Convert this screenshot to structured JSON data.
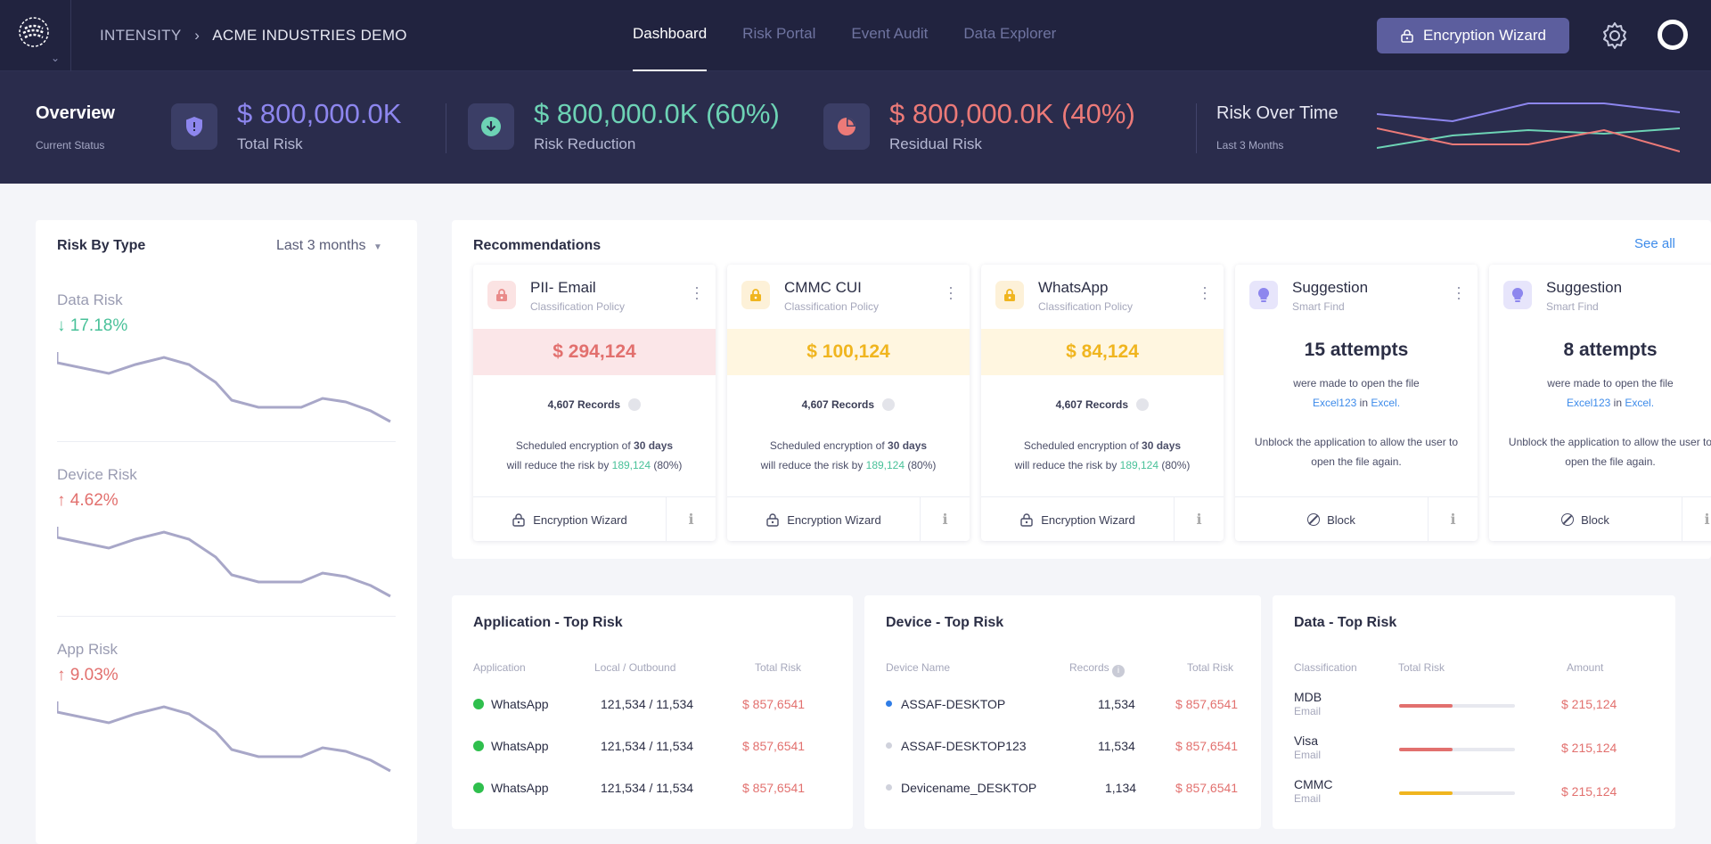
{
  "colors": {
    "total_risk": "#8d86ee",
    "risk_reduction": "#6dd3b5",
    "residual_risk": "#ec7a78",
    "up": "#e2706e",
    "down": "#49c199",
    "amber": "#f0b51f",
    "link": "#3d8bea"
  },
  "header": {
    "breadcrumb": [
      "INTENSITY",
      "ACME INDUSTRIES DEMO"
    ],
    "tabs": [
      "Dashboard",
      "Risk Portal",
      "Event Audit",
      "Data Explorer"
    ],
    "active_tab": "Dashboard",
    "encryption_button": "Encryption Wizard"
  },
  "overview": {
    "title": "Overview",
    "subtitle": "Current Status",
    "total": {
      "value": "$ 800,000.0K",
      "label": "Total Risk"
    },
    "reduction": {
      "value": "$ 800,000.0K",
      "pct": "(60%)",
      "label": "Risk Reduction"
    },
    "residual": {
      "value": "$ 800,000.0K",
      "pct": "(40%)",
      "label": "Residual Risk"
    },
    "risk_over_time": {
      "title": "Risk Over Time",
      "subtitle": "Last 3 Months"
    }
  },
  "risk_by_type": {
    "title": "Risk By Type",
    "period": "Last 3 months",
    "items": [
      {
        "name": "Data Risk",
        "change": "17.18%",
        "direction": "down"
      },
      {
        "name": "Device Risk",
        "change": "4.62%",
        "direction": "up"
      },
      {
        "name": "App Risk",
        "change": "9.03%",
        "direction": "up"
      }
    ]
  },
  "recommendations": {
    "title": "Recommendations",
    "see_all": "See all",
    "policy_cards": [
      {
        "title": "PII- Email",
        "subtitle": "Classification Policy",
        "amount": "$ 294,124",
        "records": "4,607 Records",
        "desc_a": "Scheduled encryption of ",
        "desc_bold": "30 days",
        "desc_b": "will reduce the risk by ",
        "desc_val": "189,124",
        "desc_pct": " (80%)",
        "action": "Encryption Wizard"
      },
      {
        "title": "CMMC CUI",
        "subtitle": "Classification Policy",
        "amount": "$ 100,124",
        "records": "4,607 Records",
        "desc_a": "Scheduled encryption of ",
        "desc_bold": "30 days",
        "desc_b": "will reduce the risk by ",
        "desc_val": "189,124",
        "desc_pct": " (80%)",
        "action": "Encryption Wizard"
      },
      {
        "title": "WhatsApp",
        "subtitle": "Classification Policy",
        "amount": "$ 84,124",
        "records": "4,607 Records",
        "desc_a": "Scheduled encryption of ",
        "desc_bold": "30 days",
        "desc_b": "will reduce the risk by ",
        "desc_val": "189,124",
        "desc_pct": " (80%)",
        "action": "Encryption Wizard"
      }
    ],
    "suggestion_cards": [
      {
        "title": "Suggestion",
        "subtitle": "Smart Find",
        "attempts": "15 attempts",
        "line1": "were made to open the file",
        "file": "Excel123",
        "in": " in ",
        "app": "Excel.",
        "line3": "Unblock the application to allow the user to open the file again.",
        "action": "Block"
      },
      {
        "title": "Suggestion",
        "subtitle": "Smart Find",
        "attempts": "8 attempts",
        "line1": "were made to open the file",
        "file": "Excel123",
        "in": " in ",
        "app": "Excel.",
        "line3": "Unblock the application to allow the user to open the file again.",
        "action": "Block"
      }
    ]
  },
  "app_top_risk": {
    "title": "Application - Top Risk",
    "headers": [
      "Application",
      "Local / Outbound",
      "Total Risk"
    ],
    "rows": [
      {
        "app": "WhatsApp",
        "local": "121,534 / 11,534",
        "risk": "$ 857,6541"
      },
      {
        "app": "WhatsApp",
        "local": "121,534 / 11,534",
        "risk": "$ 857,6541"
      },
      {
        "app": "WhatsApp",
        "local": "121,534 / 11,534",
        "risk": "$ 857,6541"
      }
    ]
  },
  "device_top_risk": {
    "title": "Device - Top Risk",
    "headers": [
      "Device Name",
      "Records",
      "Total Risk"
    ],
    "rows": [
      {
        "name": "ASSAF-DESKTOP",
        "records": "11,534",
        "risk": "$ 857,6541",
        "dot": "#2f7de6"
      },
      {
        "name": "ASSAF-DESKTOP123",
        "records": "11,534",
        "risk": "$ 857,6541",
        "dot": "#d0d2dc"
      },
      {
        "name": "Devicename_DESKTOP",
        "records": "1,134",
        "risk": "$ 857,6541",
        "dot": "#d0d2dc"
      }
    ]
  },
  "data_top_risk": {
    "title": "Data - Top Risk",
    "headers": [
      "Classification",
      "Total Risk",
      "Amount"
    ],
    "rows": [
      {
        "name": "MDB",
        "type": "Email",
        "risk_fraction": 0.46,
        "bar_color": "#e2706e",
        "amount": "$ 215,124"
      },
      {
        "name": "Visa",
        "type": "Email",
        "risk_fraction": 0.46,
        "bar_color": "#e2706e",
        "amount": "$ 215,124"
      },
      {
        "name": "CMMC",
        "type": "Email",
        "risk_fraction": 0.46,
        "bar_color": "#f0b51f",
        "amount": "$ 215,124"
      }
    ]
  }
}
